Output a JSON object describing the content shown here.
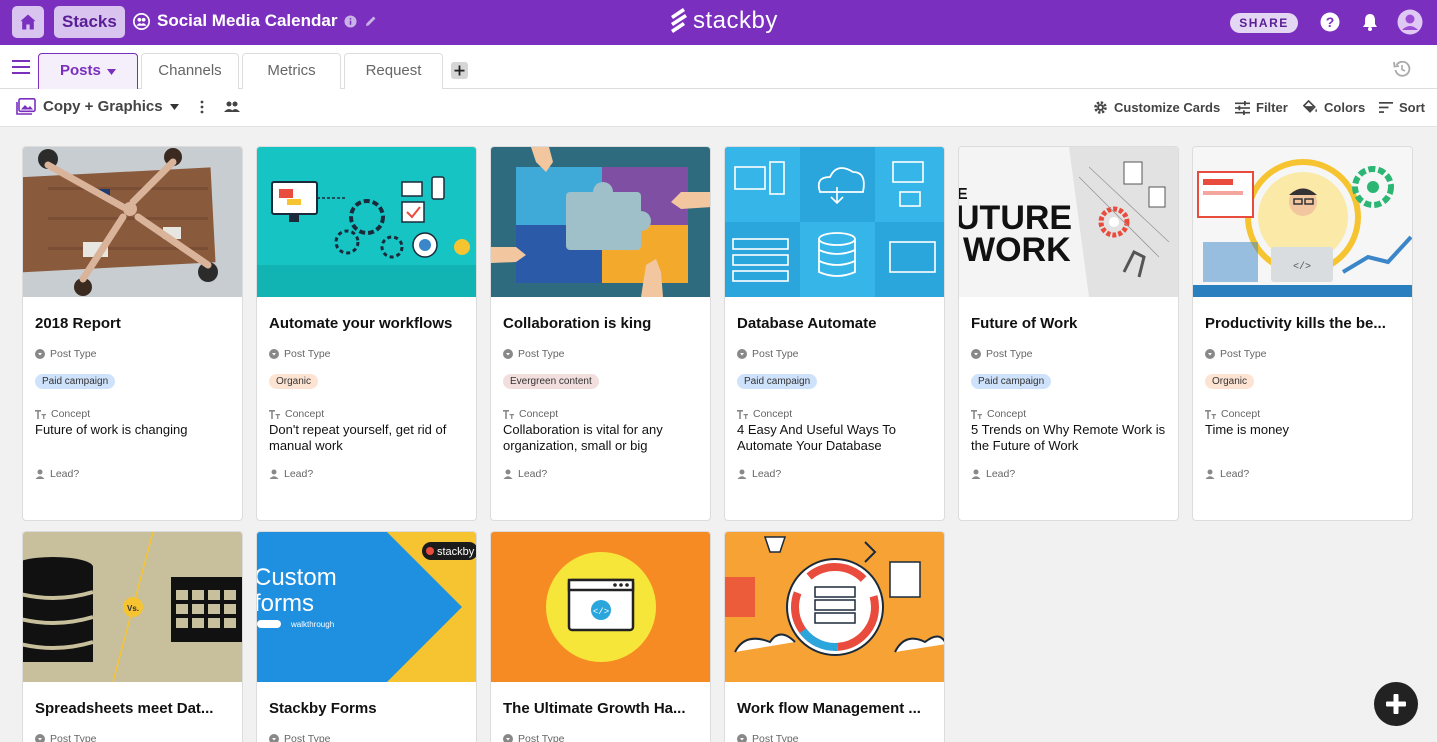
{
  "topbar": {
    "stacks_label": "Stacks",
    "stack_title": "Social Media Calendar",
    "logo_text": "stackby",
    "share_label": "SHARE",
    "accent": "#7a2fbf"
  },
  "tabs": [
    {
      "label": "Posts",
      "active": true
    },
    {
      "label": "Channels",
      "active": false
    },
    {
      "label": "Metrics",
      "active": false
    },
    {
      "label": "Request",
      "active": false
    }
  ],
  "toolbar": {
    "view_name": "Copy + Graphics",
    "customize_label": "Customize Cards",
    "filter_label": "Filter",
    "colors_label": "Colors",
    "sort_label": "Sort"
  },
  "field_labels": {
    "post_type": "Post Type",
    "concept": "Concept",
    "lead": "Lead?"
  },
  "cards": [
    {
      "title": "2018 Report",
      "post_type": "Paid campaign",
      "tag_color": "#cfe2fb",
      "concept": "Future of work is changing",
      "image": "team-handshake-image"
    },
    {
      "title": "Automate your workflows",
      "post_type": "Organic",
      "tag_color": "#fde3d2",
      "concept": "Don't repeat yourself, get rid of manual work",
      "image": "automation-illustration"
    },
    {
      "title": "Collaboration is king",
      "post_type": "Evergreen content",
      "tag_color": "#f3dede",
      "concept": "Collaboration is vital for any organization, small or big",
      "image": "puzzle-illustration"
    },
    {
      "title": "Database Automate",
      "post_type": "Paid campaign",
      "tag_color": "#cfe2fb",
      "concept": "4 Easy And Useful Ways To Automate Your Database",
      "image": "database-icons-illustration"
    },
    {
      "title": "Future of Work",
      "post_type": "Paid campaign",
      "tag_color": "#cfe2fb",
      "concept": "5 Trends on Why Remote Work is the Future of Work",
      "image": "future-of-work-illustration"
    },
    {
      "title": "Productivity kills the be...",
      "post_type": "Organic",
      "tag_color": "#fde3d2",
      "concept": "Time is money",
      "image": "productivity-illustration"
    },
    {
      "title": "Spreadsheets meet Dat...",
      "image": "spreadsheet-vs-database-illustration"
    },
    {
      "title": "Stackby Forms",
      "image": "custom-forms-banner",
      "banner_line1": "Custom",
      "banner_line2": "forms",
      "banner_small": "walkthrough",
      "banner_logo": "stackby"
    },
    {
      "title": "The Ultimate Growth Ha...",
      "image": "code-window-illustration"
    },
    {
      "title": "Work flow Management ...",
      "image": "workflow-machine-illustration"
    }
  ]
}
